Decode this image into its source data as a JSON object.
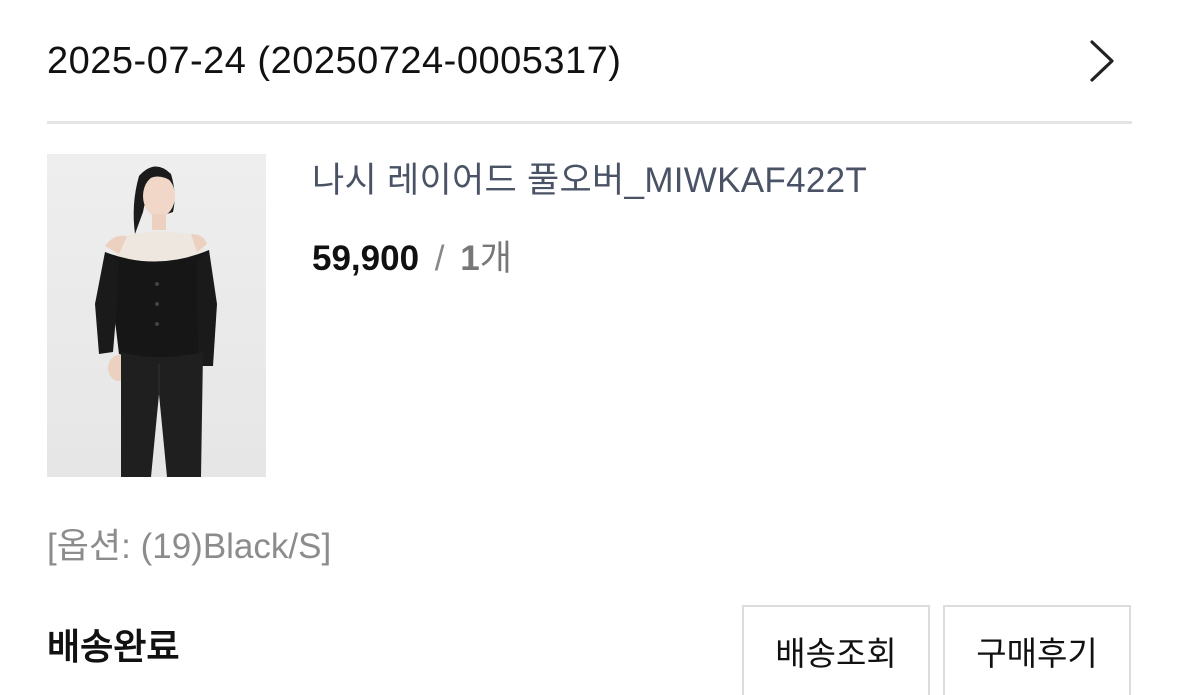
{
  "order": {
    "title": "2025-07-24 (20250724-0005317)"
  },
  "icons": {
    "detail": "chevron-right-icon"
  },
  "product": {
    "name": "나시 레이어드 풀오버_MIWKAF422T",
    "price": "59,900",
    "separator": "/",
    "quantity_number": "1",
    "quantity_unit": "개",
    "option": "[옵션: (19)Black/S]",
    "image_icon": "product-photo-woman-black-pullover"
  },
  "delivery": {
    "status": "배송완료",
    "track_button": "배송조회",
    "review_button": "구매후기"
  },
  "colors": {
    "text_primary": "#111111",
    "product_name": "#4a5265",
    "option_text": "#8c8c8c",
    "divider": "#e4e4e4",
    "button_border": "#dcdcdc"
  }
}
